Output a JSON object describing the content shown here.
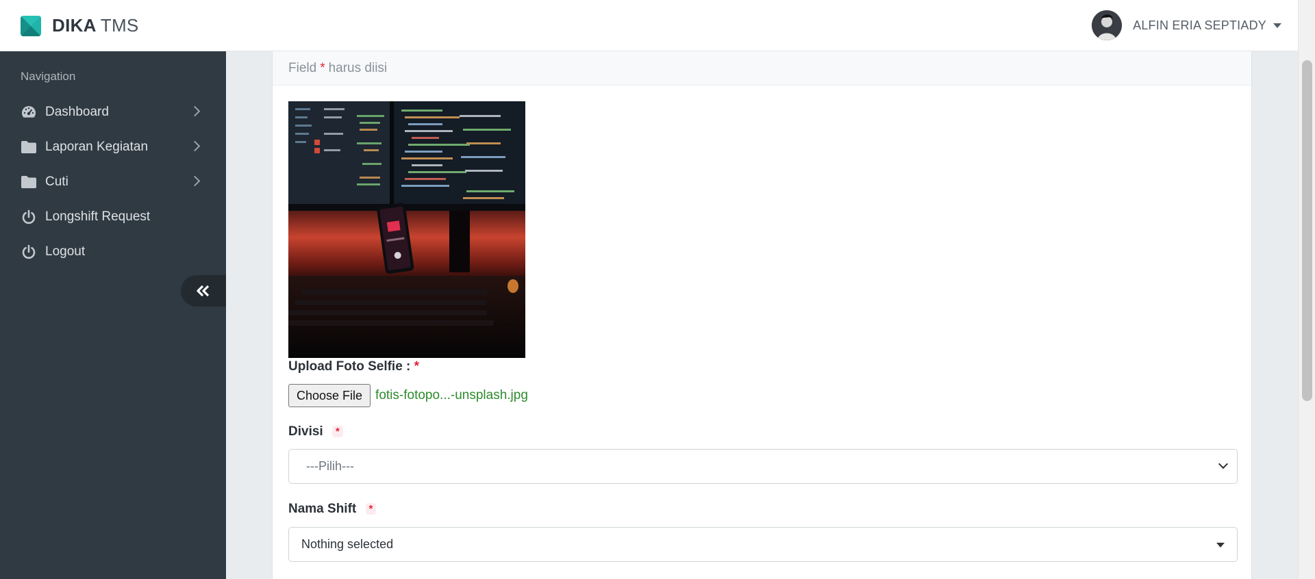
{
  "header": {
    "brand_bold": "DIKA",
    "brand_light": "TMS",
    "user_name": "ALFIN ERIA SEPTIADY"
  },
  "sidebar": {
    "heading": "Navigation",
    "items": [
      {
        "label": "Dashboard",
        "icon": "dashboard-gauge-icon",
        "has_submenu": true
      },
      {
        "label": "Laporan Kegiatan",
        "icon": "folder-icon",
        "has_submenu": true
      },
      {
        "label": "Cuti",
        "icon": "folder-icon",
        "has_submenu": true
      },
      {
        "label": "Longshift Request",
        "icon": "power-icon",
        "has_submenu": false
      },
      {
        "label": "Logout",
        "icon": "power-icon",
        "has_submenu": false
      }
    ],
    "collapse_icon": "double-chevron-left-icon"
  },
  "form": {
    "note_prefix": "Field",
    "note_star": "*",
    "note_suffix": "harus diisi",
    "upload_label": "Upload Foto Selfie :",
    "required_mark": "*",
    "file_button": "Choose File",
    "file_name": "fotis-fotopo...-unsplash.jpg",
    "divisi_label": "Divisi",
    "divisi_value": "---Pilih---",
    "shift_label": "Nama Shift",
    "shift_value": "Nothing selected"
  },
  "colors": {
    "sidebar_bg": "#303a42",
    "brand_accent": "#1aa39a",
    "required": "#e0243a",
    "file_name": "#2c8a2c"
  }
}
